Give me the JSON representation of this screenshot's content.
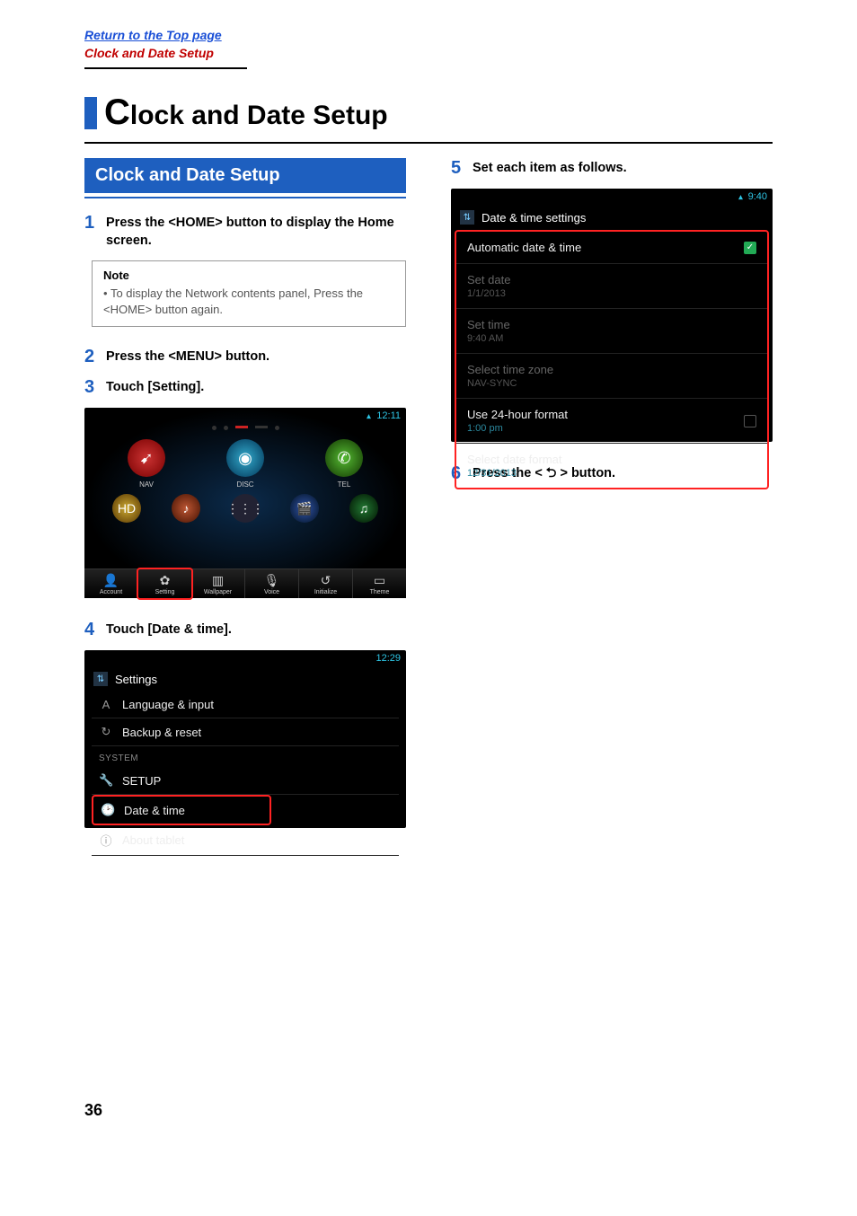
{
  "breadcrumbs": {
    "top": "Return to the Top page",
    "current": "Clock and Date Setup"
  },
  "page_title": "lock and Date Setup",
  "page_title_first": "C",
  "section_header": "Clock and Date Setup",
  "steps": {
    "s1": {
      "num": "1",
      "text": "Press the <HOME> button to display the Home screen."
    },
    "s2": {
      "num": "2",
      "text": "Press the <MENU> button."
    },
    "s3": {
      "num": "3",
      "text": "Touch [Setting]."
    },
    "s4": {
      "num": "4",
      "text": "Touch [Date & time]."
    },
    "s5": {
      "num": "5",
      "text": "Set each item as follows."
    },
    "s6": {
      "num": "6",
      "text": "Press the < ⮌ > button."
    }
  },
  "note": {
    "title": "Note",
    "body": "To display the Network contents panel, Press the <HOME> button again."
  },
  "screen1": {
    "time": "12:11",
    "main": [
      {
        "label": "NAV"
      },
      {
        "label": "DISC"
      },
      {
        "label": "TEL"
      }
    ],
    "bottom": [
      {
        "glyph": "👤",
        "label": "Account"
      },
      {
        "glyph": "✿",
        "label": "Setting"
      },
      {
        "glyph": "▥",
        "label": "Wallpaper"
      },
      {
        "glyph": "🎙",
        "label": "Voice"
      },
      {
        "glyph": "↺",
        "label": "Initialize"
      },
      {
        "glyph": "▭",
        "label": "Theme"
      }
    ]
  },
  "screen2": {
    "time": "12:29",
    "title": "Settings",
    "rows": {
      "lang": "Language & input",
      "backup": "Backup & reset",
      "section": "SYSTEM",
      "setup": "SETUP",
      "datetime": "Date & time",
      "about": "About tablet"
    }
  },
  "screen3": {
    "time": "9:40",
    "title": "Date & time settings",
    "rows": {
      "auto": {
        "label": "Automatic date & time"
      },
      "setdate": {
        "label": "Set date",
        "sub": "1/1/2013"
      },
      "settime": {
        "label": "Set time",
        "sub": "9:40 AM"
      },
      "tz": {
        "label": "Select time zone",
        "sub": "NAV-SYNC"
      },
      "h24": {
        "label": "Use 24-hour format",
        "sub": "1:00 pm"
      },
      "datefmt": {
        "label": "Select date format",
        "sub": "12/31/2013"
      }
    }
  },
  "page_number": "36"
}
